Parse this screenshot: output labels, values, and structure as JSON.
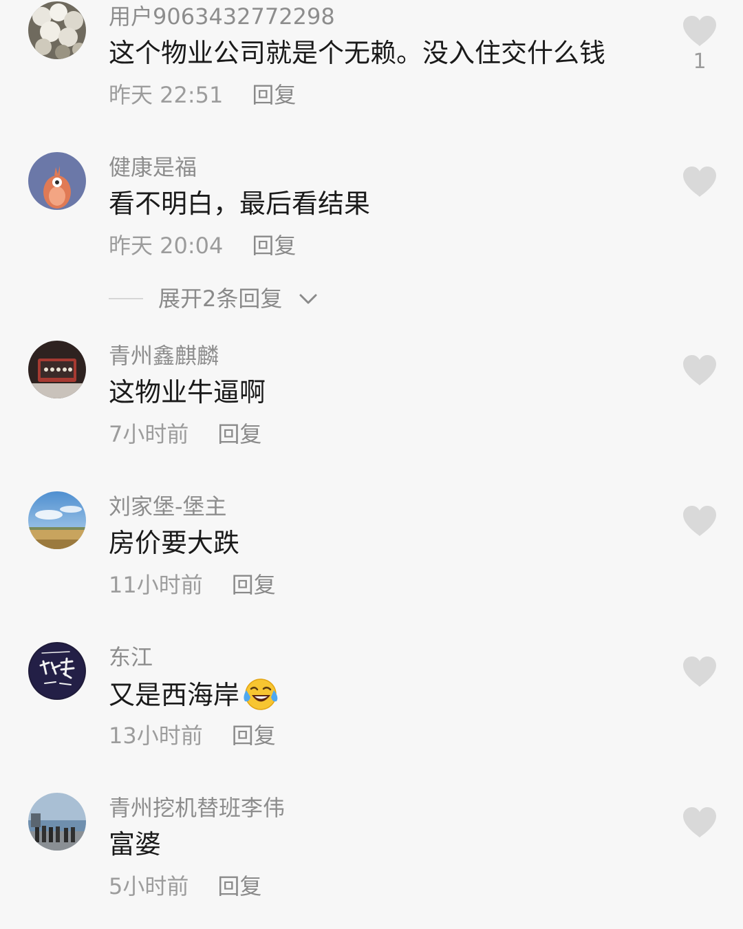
{
  "comments": [
    {
      "username": "用户9063432772298",
      "text": "这个物业公司就是个无赖。没入住交什么钱",
      "time": "昨天 22:51",
      "reply_label": "回复",
      "like_count": "1",
      "avatar_icon": "cherry-blossom-photo-avatar"
    },
    {
      "username": "健康是福",
      "text": "看不明白，最后看结果",
      "time": "昨天 20:04",
      "reply_label": "回复",
      "like_count": "",
      "avatar_icon": "cartoon-chick-avatar",
      "expand_label": "展开2条回复"
    },
    {
      "username": "青州鑫麒麟",
      "text": "这物业牛逼啊",
      "time": "7小时前",
      "reply_label": "回复",
      "like_count": "",
      "avatar_icon": "dark-room-photo-avatar"
    },
    {
      "username": "刘家堡-堡主",
      "text": "房价要大跌",
      "time": "11小时前",
      "reply_label": "回复",
      "like_count": "",
      "avatar_icon": "sky-landscape-avatar"
    },
    {
      "username": "东江",
      "text": "又是西海岸",
      "text_emoji": "laughing-crying-emoji",
      "time": "13小时前",
      "reply_label": "回复",
      "like_count": "",
      "avatar_icon": "calligraphy-avatar"
    },
    {
      "username": "青州挖机替班李伟",
      "text": "富婆",
      "time": "5小时前",
      "reply_label": "回复",
      "like_count": "",
      "avatar_icon": "seaside-people-avatar"
    }
  ],
  "colors": {
    "background": "#f7f7f7",
    "username": "#8d8d8d",
    "content": "#1a1a1a",
    "meta": "#9c9c9c",
    "like_icon": "#d9d9d9"
  }
}
